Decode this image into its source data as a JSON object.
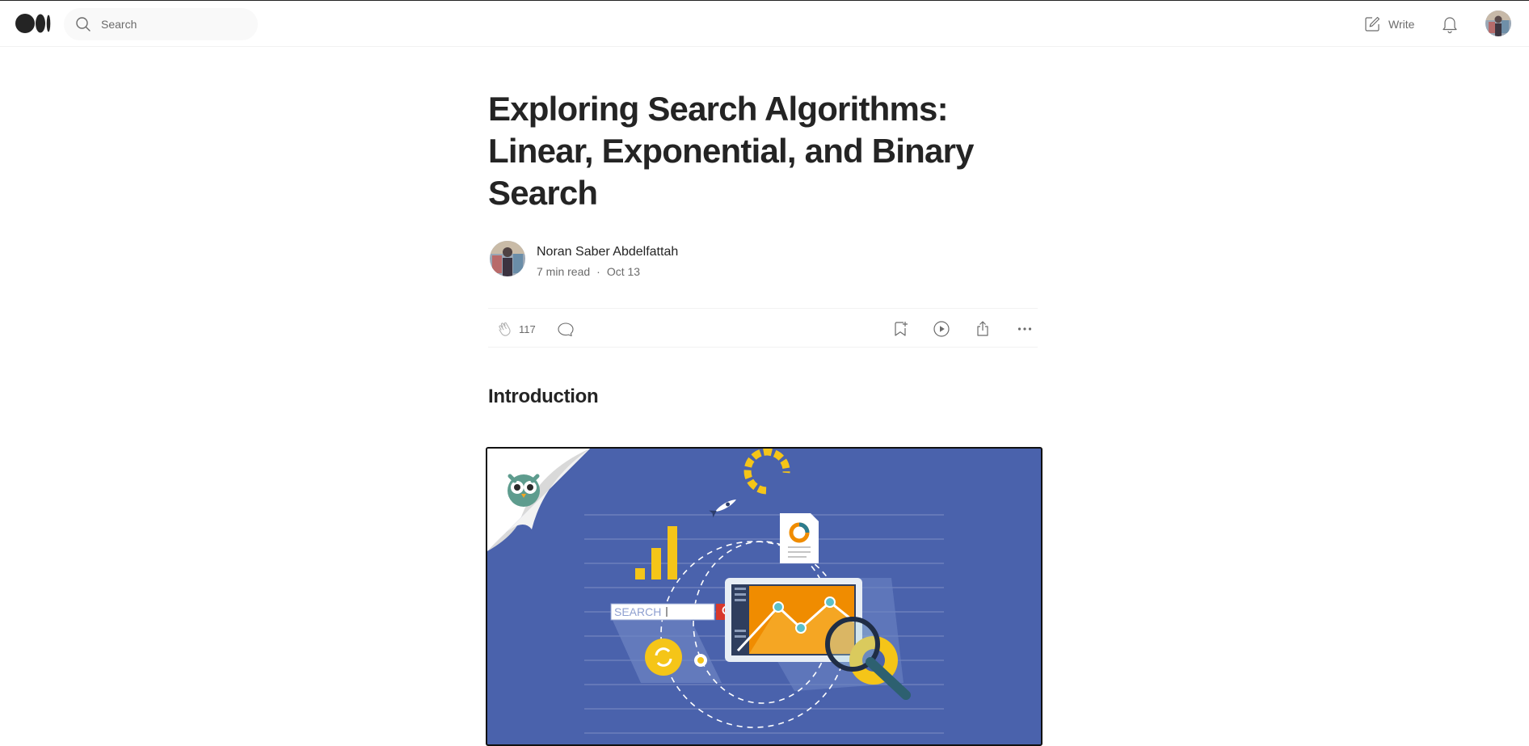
{
  "header": {
    "logo_icon": "medium-logo-icon",
    "search": {
      "placeholder": "Search",
      "icon": "search-icon"
    },
    "write_label": "Write",
    "write_icon": "pen-square-icon",
    "bell_icon": "bell-icon",
    "avatar_icon": "user-avatar"
  },
  "article": {
    "title": "Exploring Search Algorithms: Linear, Exponential, and Binary Search",
    "author": {
      "name": "Noran Saber Abdelfattah",
      "read_time": "7 min read",
      "separator": "·",
      "date": "Oct 13"
    },
    "actions": {
      "claps": "117",
      "clap_icon": "clap-icon",
      "comment_icon": "comment-icon",
      "save_icon": "bookmark-add-icon",
      "listen_icon": "play-icon",
      "share_icon": "share-icon",
      "more_icon": "more-dots-icon"
    },
    "section_heading": "Introduction",
    "figure": {
      "search_box_text": "SEARCH",
      "background_color": "#4a62ac",
      "accent_orange": "#f08c00",
      "accent_yellow": "#f5c518"
    }
  },
  "colors": {
    "text": "#242424",
    "muted": "#6b6b6b",
    "divider": "#f2f2f2"
  }
}
